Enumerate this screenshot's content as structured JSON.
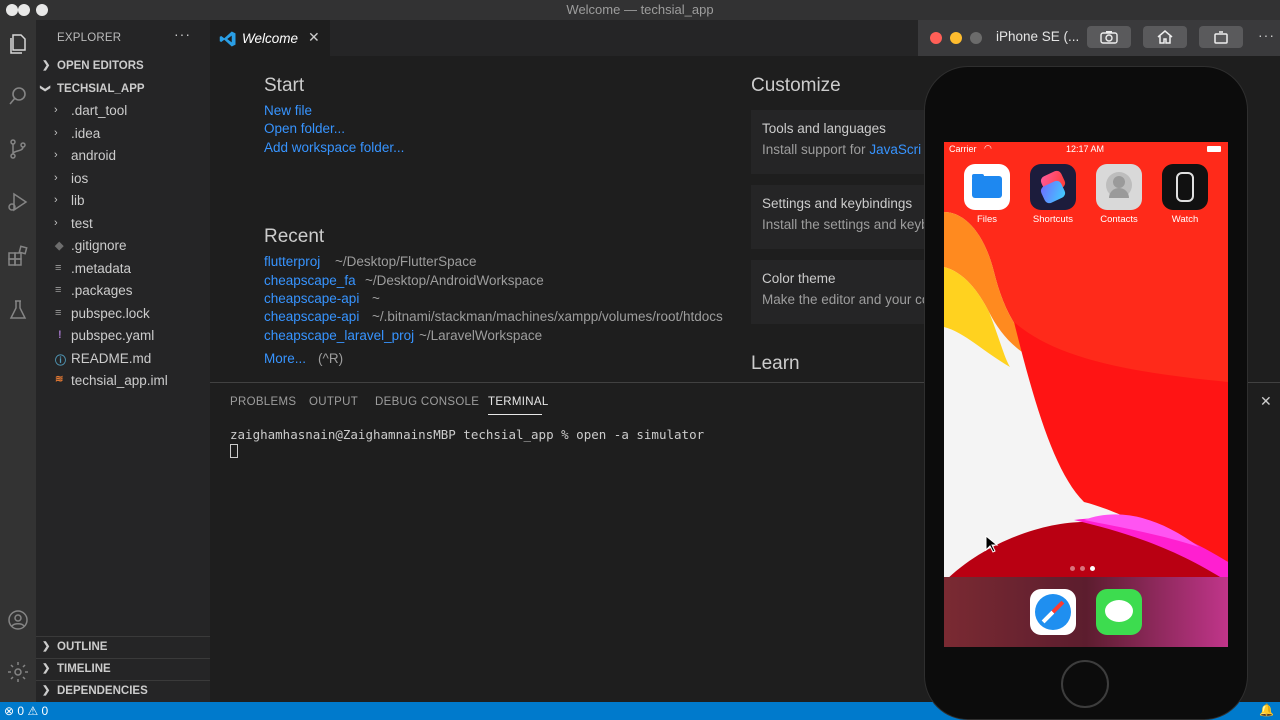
{
  "window": {
    "title": "Welcome — techsial_app"
  },
  "activity_bar": {
    "icons": [
      "explorer-icon",
      "search-icon",
      "source-control-icon",
      "run-debug-icon",
      "extensions-icon",
      "testing-icon",
      "account-icon",
      "manage-gear-icon"
    ]
  },
  "sidebar": {
    "header": "EXPLORER",
    "more": "···",
    "open_editors": "OPEN EDITORS",
    "project": "TECHSIAL_APP",
    "items": [
      {
        "label": ".dart_tool"
      },
      {
        "label": ".idea"
      },
      {
        "label": "android"
      },
      {
        "label": "ios"
      },
      {
        "label": "lib"
      },
      {
        "label": "test"
      },
      {
        "label": ".gitignore"
      },
      {
        "label": ".metadata"
      },
      {
        "label": ".packages"
      },
      {
        "label": "pubspec.lock"
      },
      {
        "label": "pubspec.yaml"
      },
      {
        "label": "README.md"
      },
      {
        "label": "techsial_app.iml"
      }
    ],
    "outline": "OUTLINE",
    "timeline": "TIMELINE",
    "dependencies": "DEPENDENCIES"
  },
  "tab": {
    "label": "Welcome",
    "close": "✕"
  },
  "welcome": {
    "start_heading": "Start",
    "start_links": [
      "New file",
      "Open folder...",
      "Add workspace folder..."
    ],
    "recent_heading": "Recent",
    "recent": [
      {
        "name": "flutterproj",
        "path": "~/Desktop/FlutterSpace"
      },
      {
        "name": "cheapscape_fa",
        "path": "~/Desktop/AndroidWorkspace"
      },
      {
        "name": "cheapscape-api",
        "path": "~"
      },
      {
        "name": "cheapscape-api",
        "path": "~/.bitnami/stackman/machines/xampp/volumes/root/htdocs"
      },
      {
        "name": "cheapscape_laravel_proj",
        "path": "~/LaravelWorkspace"
      }
    ],
    "more": "More...",
    "more_shortcut": "(^R)",
    "customize_heading": "Customize",
    "cards": [
      {
        "title": "Tools and languages",
        "desc": "Install support for ",
        "desc_link": "JavaScri"
      },
      {
        "title": "Settings and keybindings",
        "desc": "Install the settings and keyb",
        "desc_link": ""
      },
      {
        "title": "Color theme",
        "desc": "Make the editor and your co",
        "desc_link": ""
      }
    ],
    "learn_heading": "Learn"
  },
  "panel": {
    "tabs": [
      "PROBLEMS",
      "OUTPUT",
      "DEBUG CONSOLE",
      "TERMINAL"
    ],
    "active_tab": "TERMINAL",
    "close": "✕",
    "terminal_line": "zaighamhasnain@ZaighamnainsMBP techsial_app % open -a simulator"
  },
  "status_bar": {
    "errors": "0",
    "warnings": "0"
  },
  "simulator": {
    "title": "iPhone SE (...",
    "more": "···",
    "carrier": "Carrier",
    "time": "12:17 AM",
    "apps": [
      "Files",
      "Shortcuts",
      "Contacts",
      "Watch"
    ],
    "dock": [
      "safari-icon",
      "messages-icon"
    ],
    "page_count": 3,
    "active_page": 3
  },
  "colors": {
    "accent": "#007acc",
    "link": "#3794ff",
    "wallpaper_red": "#ff1f1f"
  }
}
